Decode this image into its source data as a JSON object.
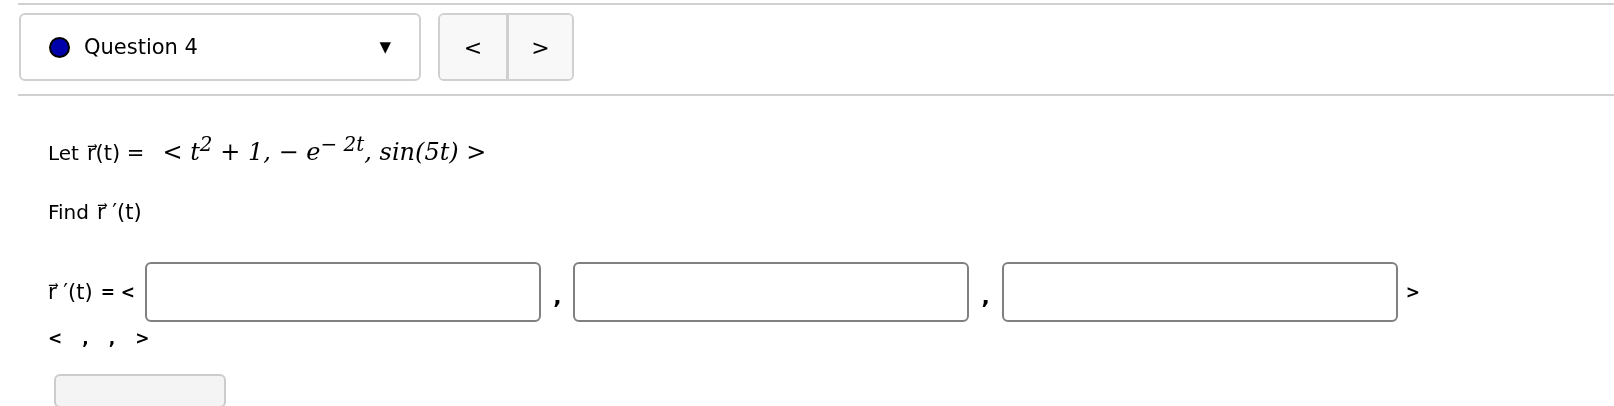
{
  "question_select": {
    "label": "Question 4",
    "color": "#0000aa",
    "caret": "▼"
  },
  "nav": {
    "prev": "<",
    "next": ">"
  },
  "statement": {
    "lead": "Let",
    "vector": "r⃗(t) =",
    "formula": "< t$^{2}$ + 1,  − e$^{− 2t}$, sin(5t) >"
  },
  "task": {
    "lead": "Find",
    "vector": "r⃗ ′(t)"
  },
  "answer": {
    "vector": "r⃗ ′(t)",
    "open": "= <",
    "separators": [
      ",",
      ","
    ],
    "close": ">",
    "inputs": [
      {
        "kind": "text"
      },
      {
        "kind": "text"
      },
      {
        "kind": "text"
      }
    ]
  },
  "preview": [
    "<",
    ",",
    ",",
    ">"
  ]
}
